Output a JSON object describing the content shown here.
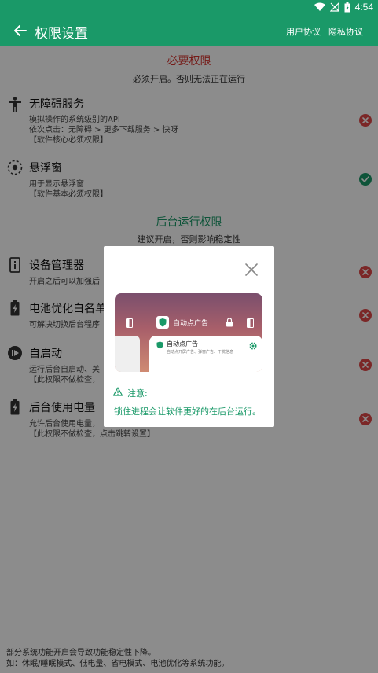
{
  "status_bar": {
    "time": "4:54"
  },
  "app_bar": {
    "title": "权限设置",
    "user_agreement": "用户协议",
    "privacy_policy": "隐私协议"
  },
  "required_section": {
    "title": "必要权限",
    "subtitle": "必须开启。否则无法正在运行"
  },
  "required_permissions": [
    {
      "title": "无障碍服务",
      "desc": [
        "模拟操作的系统级别的API",
        "依次点击：无障碍 > 更多下载服务 > 快呀",
        "【软件核心必须权限】"
      ],
      "status": "off"
    },
    {
      "title": "悬浮窗",
      "desc": [
        "用于显示悬浮窗",
        "【软件基本必须权限】"
      ],
      "status": "on"
    }
  ],
  "background_section": {
    "title": "后台运行权限",
    "subtitle": "建议开启，否则影响稳定性"
  },
  "background_permissions": [
    {
      "title": "设备管理器",
      "desc": [
        "开启之后可以加强后"
      ],
      "status": "off"
    },
    {
      "title": "电池优化白名单",
      "desc": [
        "可解决切换后台程序"
      ],
      "status": "off"
    },
    {
      "title": "自启动",
      "desc": [
        "运行后台自启动、关",
        "【此权限不做检查，"
      ],
      "status": "off"
    },
    {
      "title": "后台使用电量",
      "desc": [
        "允许后台使用电量，",
        "【此权限不做检查，点击跳转设置】"
      ],
      "status": "off"
    }
  ],
  "footer": {
    "line1": "部分系统功能开启会导致功能稳定性下降。",
    "line2": "如：休眠/睡眠模式、低电量、省电模式、电池优化等系统功能。"
  },
  "dialog": {
    "promo_title": "自动点广告",
    "promo_card_title": "自动点广告",
    "promo_card_desc": "自动点开屏广告、弹窗广告、干扰信息",
    "promo_dots": "···",
    "notice_label": "注意:",
    "notice_text": "锁住进程会让软件更好的在后台运行。"
  },
  "colors": {
    "primary": "#1a9968",
    "danger": "#e04848",
    "section_red": "#d6332f"
  }
}
